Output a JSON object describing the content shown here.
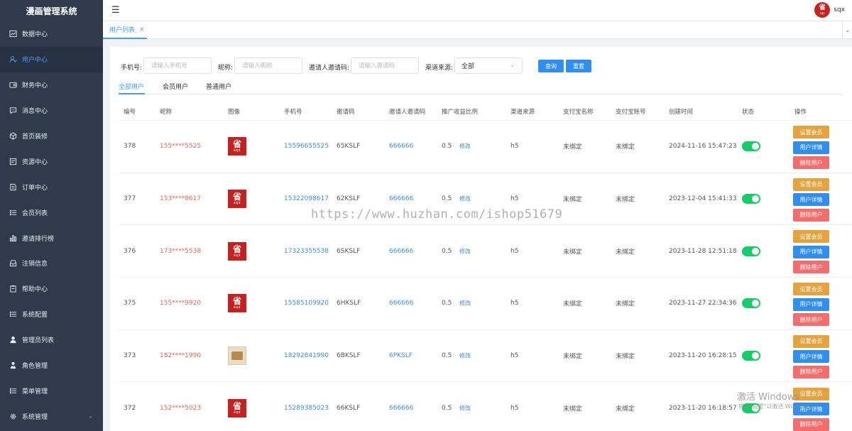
{
  "app": {
    "title": "漫画管理系统",
    "username": "sqx"
  },
  "header": {
    "menu_icon": "hamburger-icon"
  },
  "avatar": {
    "big": "省",
    "small": "sqx"
  },
  "sidebar": {
    "items": [
      {
        "label": "数据中心",
        "icon": "chart-icon",
        "active": false
      },
      {
        "label": "用户中心",
        "icon": "user-icon",
        "active": true
      },
      {
        "label": "财务中心",
        "icon": "wallet-icon",
        "active": false
      },
      {
        "label": "消息中心",
        "icon": "message-icon",
        "active": false
      },
      {
        "label": "首页装修",
        "icon": "cube-icon",
        "active": false
      },
      {
        "label": "资源中心",
        "icon": "folder-icon",
        "active": false
      },
      {
        "label": "订单中心",
        "icon": "order-icon",
        "active": false
      },
      {
        "label": "会员列表",
        "icon": "list-icon",
        "active": false
      },
      {
        "label": "邀请排行榜",
        "icon": "bar-chart-icon",
        "active": false
      },
      {
        "label": "注销信息",
        "icon": "inbox-icon",
        "active": false
      },
      {
        "label": "帮助中心",
        "icon": "clipboard-icon",
        "active": false
      },
      {
        "label": "系统配置",
        "icon": "list-icon",
        "active": false
      },
      {
        "label": "管理员列表",
        "icon": "person-icon",
        "active": false
      },
      {
        "label": "角色管理",
        "icon": "role-icon",
        "active": false
      },
      {
        "label": "菜单管理",
        "icon": "list-icon",
        "active": false
      },
      {
        "label": "系统管理",
        "icon": "gear-icon",
        "active": false
      }
    ]
  },
  "tabs": {
    "active_label": "用户列表",
    "close": "×"
  },
  "filters": {
    "phone_label": "手机号:",
    "phone_placeholder": "请输入手机号",
    "nickname_label": "昵称:",
    "nickname_placeholder": "请输入昵称",
    "invite_code_label": "邀请人邀请码:",
    "invite_code_placeholder": "请输入邀请码",
    "channel_label": "渠道来源:",
    "channel_value": "全部",
    "search_button": "查询",
    "reset_button": "重置"
  },
  "user_type_tabs": [
    "全部用户",
    "会员用户",
    "普通用户"
  ],
  "table": {
    "headers": [
      "编号",
      "昵称",
      "图像",
      "手机号",
      "邀请码",
      "邀请人邀请码",
      "推广收益比例",
      "渠道来源",
      "支付宝名称",
      "支付宝账号",
      "创建时间",
      "状态",
      "操作"
    ],
    "edit_label": "修改",
    "btn_set_vip": "设置会员",
    "btn_detail": "用户详情",
    "btn_delete": "删除用户",
    "rows": [
      {
        "id": "378",
        "nickname": "155****5525",
        "avatar": "sqx",
        "phone": "15596655525",
        "invite_code": "65KSLF",
        "inviter_code": "666666",
        "ratio": "0.5",
        "channel": "h5",
        "alipay_name": "未绑定",
        "alipay_account": "未绑定",
        "created": "2024-11-16 15:47:23",
        "status": true
      },
      {
        "id": "377",
        "nickname": "153****8617",
        "avatar": "sqx",
        "phone": "15322098617",
        "invite_code": "62KSLF",
        "inviter_code": "666666",
        "ratio": "0.5",
        "channel": "h5",
        "alipay_name": "未绑定",
        "alipay_account": "未绑定",
        "created": "2023-12-04 15:41:33",
        "status": true
      },
      {
        "id": "376",
        "nickname": "173****5538",
        "avatar": "sqx",
        "phone": "17323355538",
        "invite_code": "6SKSLF",
        "inviter_code": "666666",
        "ratio": "0.5",
        "channel": "h5",
        "alipay_name": "未绑定",
        "alipay_account": "未绑定",
        "created": "2023-11-28 12:51:18",
        "status": true
      },
      {
        "id": "375",
        "nickname": "155****9920",
        "avatar": "sqx",
        "phone": "15585109920",
        "invite_code": "6HKSLF",
        "inviter_code": "666666",
        "ratio": "0.5",
        "channel": "h5",
        "alipay_name": "未绑定",
        "alipay_account": "未绑定",
        "created": "2023-11-27 22:34:36",
        "status": true
      },
      {
        "id": "373",
        "nickname": "182****1990",
        "avatar": "photo",
        "phone": "18292841990",
        "invite_code": "6BKSLF",
        "inviter_code": "6PKSLF",
        "ratio": "0.5",
        "channel": "h5",
        "alipay_name": "未绑定",
        "alipay_account": "未绑定",
        "created": "2023-11-20 16:28:15",
        "status": true
      },
      {
        "id": "372",
        "nickname": "152****5023",
        "avatar": "sqx",
        "phone": "15289385023",
        "invite_code": "66KSLF",
        "inviter_code": "666666",
        "ratio": "0.5",
        "channel": "h5",
        "alipay_name": "未绑定",
        "alipay_account": "未绑定",
        "created": "2023-11-20 16:18:57",
        "status": true
      }
    ]
  },
  "overlay": {
    "watermark": "https://www.huzhan.com/ishop51679",
    "windows_activate": "激活 Windows",
    "windows_activate_sub": "转到\"设置\"以激活 Windows。"
  },
  "colors": {
    "sidebar_bg": "#2f3b4c",
    "accent": "#409eff",
    "toggle_on": "#13ce66",
    "btn_warning": "#e6a23c",
    "btn_danger": "#f56c6c"
  }
}
